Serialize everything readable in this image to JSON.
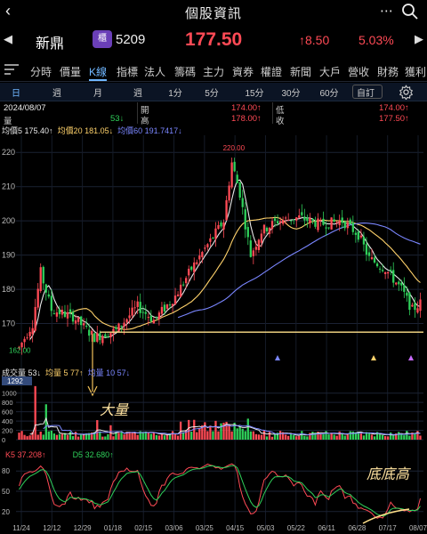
{
  "header": {
    "back_icon": "chevron-left-icon",
    "title": "個股資訊",
    "more_icon": "ellipsis-icon",
    "search_icon": "search-icon"
  },
  "quote": {
    "name": "新鼎",
    "market_badge": "櫃",
    "code": "5209",
    "price": "177.50",
    "change": "↑8.50",
    "change_pct": "5.03%",
    "prev_icon": "triangle-left-icon",
    "next_icon": "triangle-right-icon"
  },
  "tabs": [
    "分時",
    "價量",
    "K線",
    "指標",
    "法人",
    "籌碼",
    "主力",
    "資券",
    "權證",
    "新聞",
    "大戶",
    "營收",
    "財務",
    "獲利"
  ],
  "active_tab": "K線",
  "periods": [
    "日",
    "週",
    "月",
    "週",
    "1分",
    "5分",
    "15分",
    "30分",
    "60分",
    "自訂"
  ],
  "active_period": "日",
  "settings_icon": "gear-icon",
  "ohlc": {
    "date": "2024/08/07",
    "vol_label": "量",
    "vol": "53↓",
    "open_label": "開",
    "open": "174.00↑",
    "high_label": "高",
    "high": "178.00↑",
    "low_label": "低",
    "low": "174.00↑",
    "close_label": "收",
    "close": "177.50↑"
  },
  "ma_legend": [
    {
      "label": "均價5 175.40↑",
      "color": "#e8e8e8"
    },
    {
      "label": "均價20 181.05↓",
      "color": "#ffd26b"
    },
    {
      "label": "均價60 191.7417↓",
      "color": "#7a86ff"
    }
  ],
  "volume_legend": [
    {
      "label": "成交量 53↓",
      "color": "#e8e8e8"
    },
    {
      "label": "均量 5 77↑",
      "color": "#ffd26b"
    },
    {
      "label": "均量 10 57↓",
      "color": "#7a86ff"
    }
  ],
  "kd_legend": [
    {
      "label": "K5 37.208↑",
      "color": "#ff4a55"
    },
    {
      "label": "D5 32.680↑",
      "color": "#2fd05a"
    }
  ],
  "annotations": {
    "volume_note": "大量",
    "kd_note": "底底高",
    "peak": "220.00",
    "low_mark": "162.00",
    "vol_max": "1292"
  },
  "chart_data": {
    "type": "candlestick",
    "price_ylim": [
      160,
      225
    ],
    "price_ticks": [
      170,
      180,
      190,
      200,
      210,
      220
    ],
    "x_tick_labels": [
      "11/24",
      "12/12",
      "12/29",
      "01/18",
      "02/15",
      "03/06",
      "03/25",
      "04/15",
      "05/03",
      "05/22",
      "06/11",
      "06/28",
      "07/17",
      "08/07"
    ],
    "volume_ticks": [
      0,
      200,
      400,
      600,
      800,
      1000
    ],
    "volume_ylim": [
      0,
      1300
    ],
    "kd_ticks": [
      20,
      50,
      80
    ],
    "up_color": "#ff4a55",
    "down_color": "#2fd05a"
  }
}
